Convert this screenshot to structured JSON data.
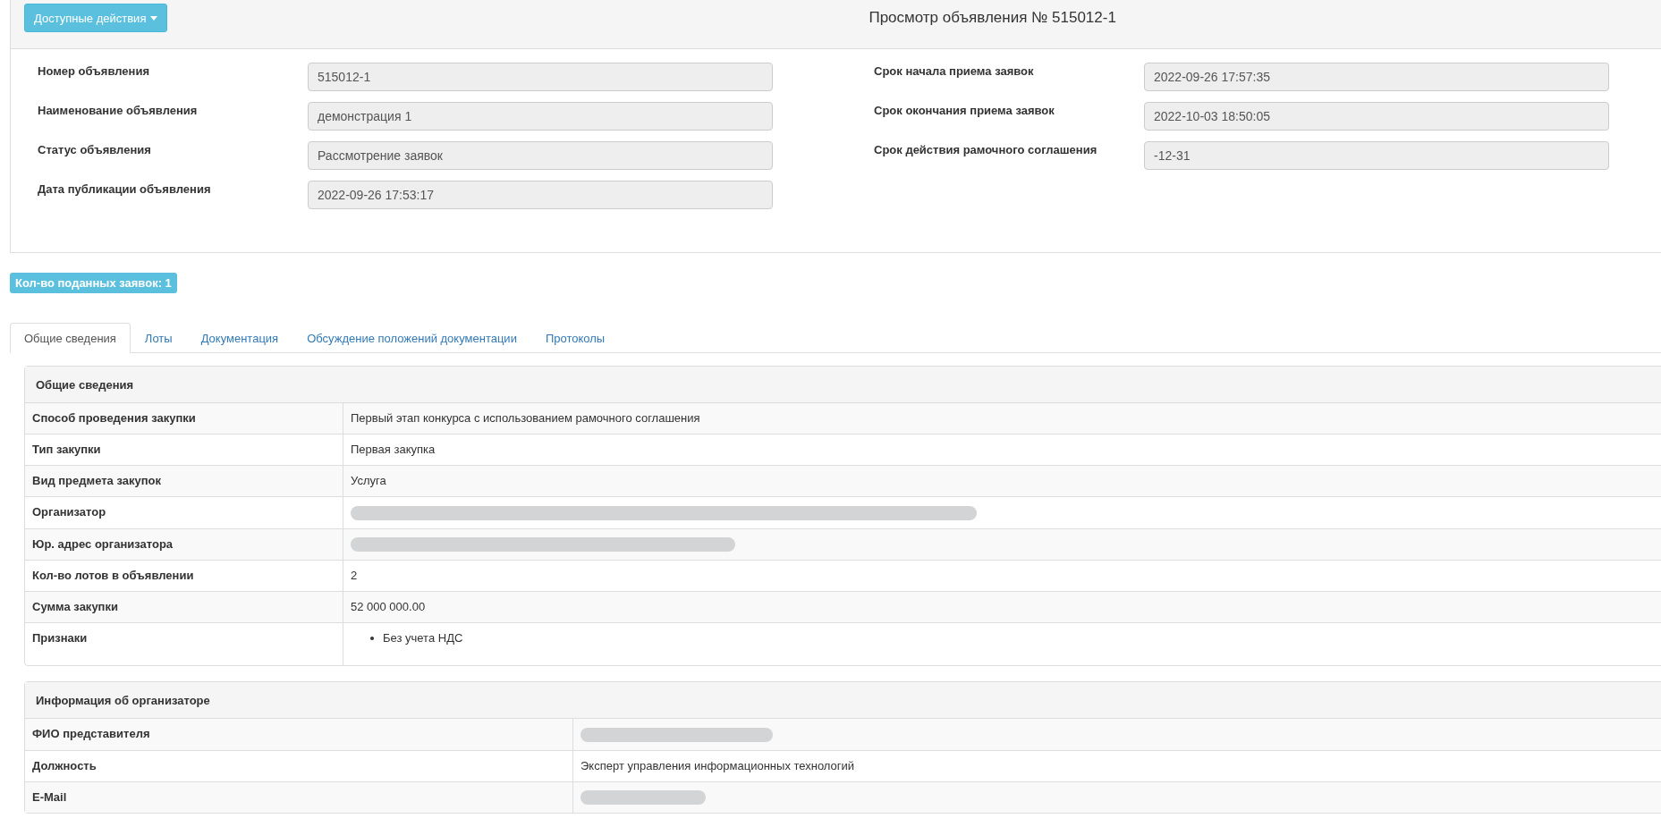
{
  "header": {
    "actions_button": "Доступные действия",
    "title": "Просмотр объявления № 515012-1"
  },
  "fields_left": [
    {
      "label": "Номер объявления",
      "value": "515012-1"
    },
    {
      "label": "Наименование объявления",
      "value": "демонстрация 1"
    },
    {
      "label": "Статус объявления",
      "value": "Рассмотрение заявок"
    },
    {
      "label": "Дата публикации объявления",
      "value": "2022-09-26 17:53:17"
    }
  ],
  "fields_right": [
    {
      "label": "Срок начала приема заявок",
      "value": "2022-09-26 17:57:35"
    },
    {
      "label": "Срок окончания приема заявок",
      "value": "2022-10-03 18:50:05"
    },
    {
      "label": "Срок действия рамочного соглашения",
      "value": "-12-31"
    }
  ],
  "badge": "Кол-во поданных заявок: 1",
  "tabs": [
    {
      "label": "Общие сведения",
      "selected": true
    },
    {
      "label": "Лоты",
      "selected": false
    },
    {
      "label": "Документация",
      "selected": false
    },
    {
      "label": "Обсуждение положений документации",
      "selected": false
    },
    {
      "label": "Протоколы",
      "selected": false
    }
  ],
  "sections": [
    {
      "title": "Общие сведения",
      "rows": [
        {
          "kind": "text",
          "label": "Способ проведения закупки",
          "value": "Первый этап конкурса с использованием рамочного соглашения"
        },
        {
          "kind": "text",
          "label": "Тип закупки",
          "value": "Первая закупка"
        },
        {
          "kind": "text",
          "label": "Вид предмета закупок",
          "value": "Услуга"
        },
        {
          "kind": "redacted",
          "label": "Организатор"
        },
        {
          "kind": "redacted",
          "label": "Юр. адрес организатора"
        },
        {
          "kind": "text",
          "label": "Кол-во лотов в объявлении",
          "value": "2"
        },
        {
          "kind": "text",
          "label": "Сумма закупки",
          "value": "52 000 000.00"
        },
        {
          "kind": "list",
          "label": "Признаки",
          "items": [
            "Без учета НДС"
          ]
        }
      ]
    },
    {
      "title": "Информация об организаторе",
      "rows": [
        {
          "kind": "redacted",
          "label": "ФИО представителя"
        },
        {
          "kind": "text",
          "label": "Должность",
          "value": "Эксперт управления информационных технологий"
        },
        {
          "kind": "redacted",
          "label": "E-Mail"
        }
      ]
    }
  ]
}
